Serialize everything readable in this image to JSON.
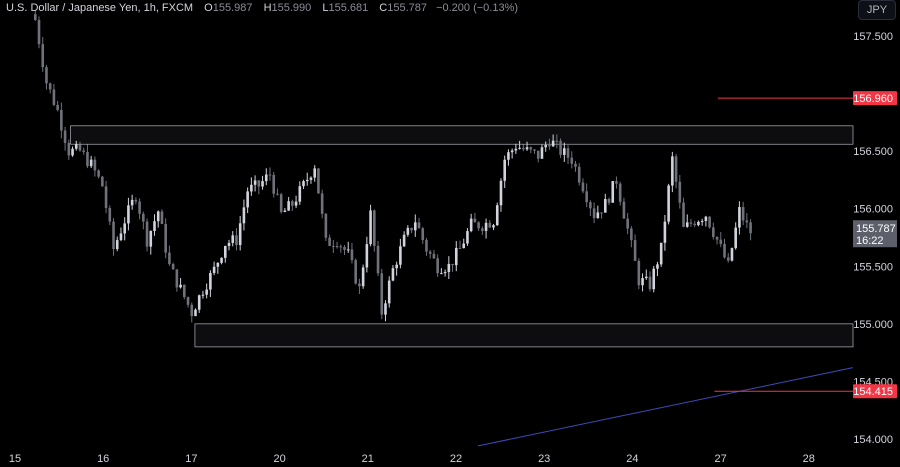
{
  "header": {
    "title": "U.S. Dollar / Japanese Yen, 1h, FXCM",
    "o_label": "O",
    "o": "155.987",
    "h_label": "H",
    "h": "155.990",
    "l_label": "L",
    "l": "155.681",
    "c_label": "C",
    "c": "155.787",
    "change": "−0.200 (−0.13%)"
  },
  "currency_button": "JPY",
  "chart_data": {
    "type": "candlestick",
    "title": "U.S. Dollar / Japanese Yen, 1h, FXCM",
    "ylim": [
      153.86,
      157.81
    ],
    "y_ticks": [
      "157.500",
      "156.500",
      "156.000",
      "155.500",
      "155.000",
      "154.500",
      "154.000"
    ],
    "y_tick_values": [
      157.5,
      156.5,
      156.0,
      155.5,
      155.0,
      154.5,
      154.0
    ],
    "x_ticks": [
      "15",
      "16",
      "17",
      "20",
      "21",
      "22",
      "23",
      "24",
      "27",
      "28"
    ],
    "x_range_days": [
      0,
      9.2
    ],
    "x_start_day": 0.23,
    "x_end_day": 8.34,
    "closes": [
      157.64,
      157.1,
      156.85,
      156.5,
      156.5,
      156.38,
      156.2,
      155.65,
      155.9,
      156.12,
      155.73,
      155.98,
      155.5,
      155.3,
      155.1,
      155.3,
      155.47,
      155.7,
      155.73,
      156.16,
      156.2,
      156.3,
      155.95,
      156.04,
      156.2,
      156.38,
      155.7,
      155.73,
      155.6,
      155.3,
      155.95,
      155.1,
      155.47,
      155.73,
      155.9,
      155.65,
      155.5,
      155.5,
      155.65,
      155.86,
      155.86,
      155.9,
      156.43,
      156.55,
      156.5,
      156.46,
      156.6,
      156.5,
      156.43,
      156.2,
      155.95,
      156.04,
      156.25,
      155.82,
      155.38,
      155.34,
      155.65,
      156.43,
      155.82,
      155.9,
      155.95,
      155.73,
      155.5,
      155.98,
      155.787
    ],
    "zones": [
      {
        "name": "resistance-zone",
        "from_day": 0.63,
        "top": 156.72,
        "bottom": 156.56
      },
      {
        "name": "support-zone",
        "from_day": 2.04,
        "top": 155.0,
        "bottom": 154.8
      }
    ],
    "levels": [
      {
        "price": 156.96,
        "label": "156.960",
        "from_day": 7.97,
        "color": "#f23645"
      },
      {
        "price": 154.415,
        "label": "154.415",
        "from_day": 7.93,
        "color": "#f23645"
      }
    ],
    "trendline": {
      "from": [
        5.25,
        153.94
      ],
      "to": [
        9.5,
        154.62
      ],
      "color": "#3f4ab8"
    },
    "last_price": {
      "price": 155.787,
      "label": "155.787",
      "countdown": "16:22"
    },
    "colors": {
      "up": "#d1d4dc",
      "down": "#6f727a",
      "zone_border": "#b2b5be",
      "grid_text": "#d1d4dc"
    }
  }
}
